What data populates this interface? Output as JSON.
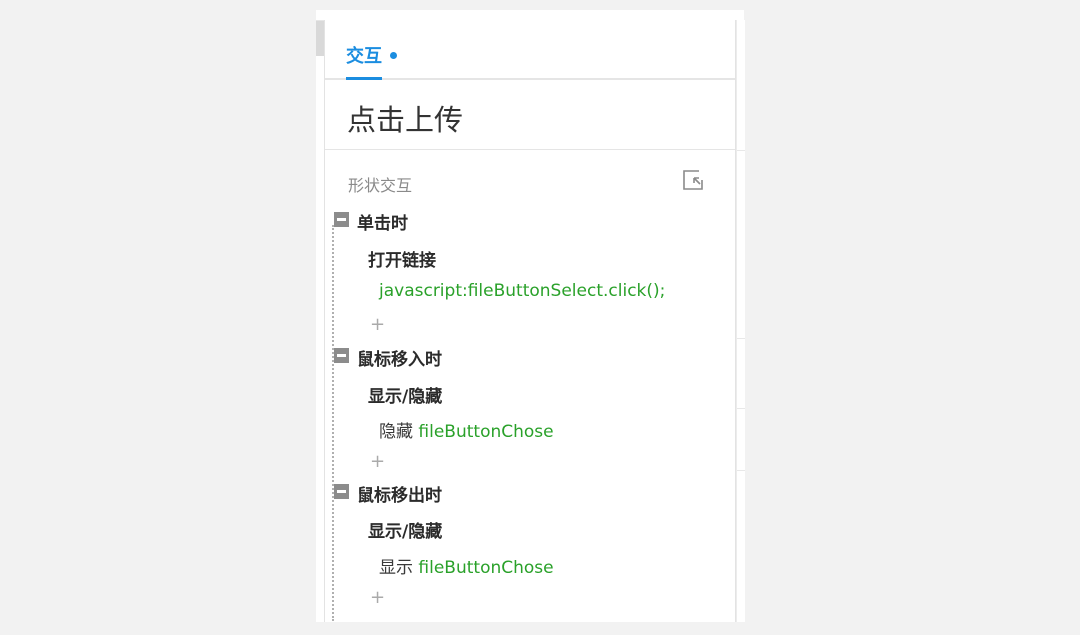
{
  "tabs": [
    {
      "label": "交互"
    }
  ],
  "widget_name": "点击上传",
  "section_label": "形状交互",
  "colors": {
    "accent": "#1b8de0",
    "target_text": "#2aa12a",
    "collapse_button": "#8c8c8c"
  },
  "icons": {
    "section_action": "collapse-all-icon"
  },
  "events": [
    {
      "label": "单击时",
      "action": "打开链接",
      "detail_prefix": "",
      "detail_target": "javascript:fileButtonSelect.click();",
      "add": "+"
    },
    {
      "label": "鼠标移入时",
      "action": "显示/隐藏",
      "detail_prefix": "隐藏",
      "detail_target": "fileButtonChose",
      "add": "+"
    },
    {
      "label": "鼠标移出时",
      "action": "显示/隐藏",
      "detail_prefix": "显示",
      "detail_target": "fileButtonChose",
      "add": "+"
    }
  ]
}
